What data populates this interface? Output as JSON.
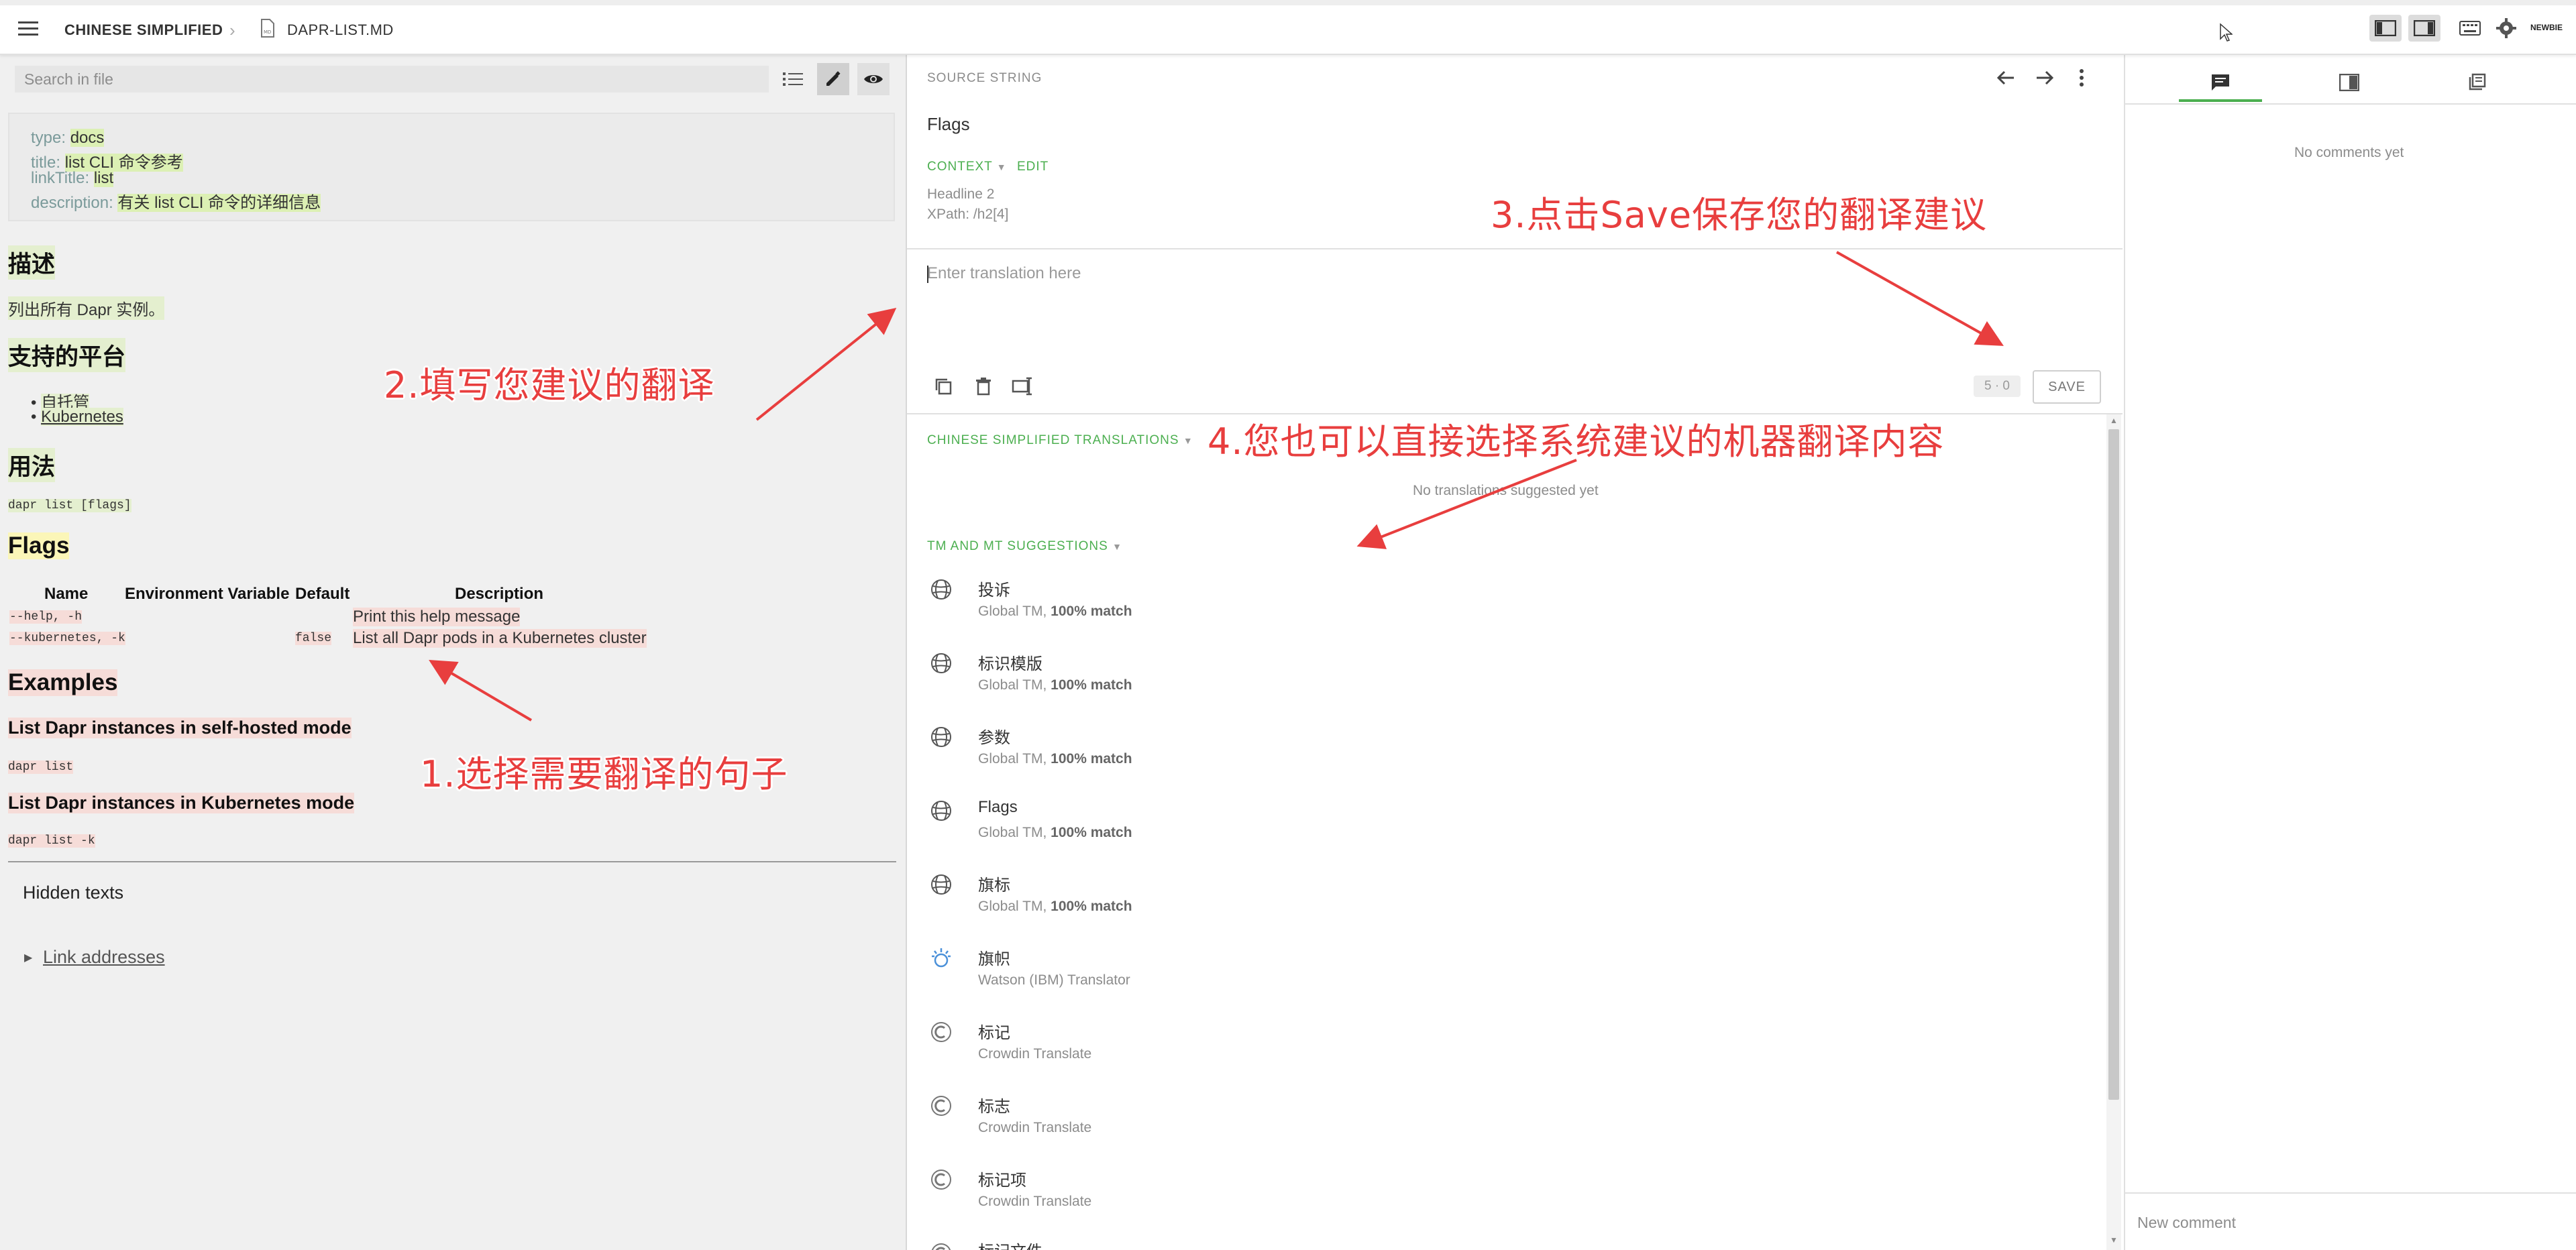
{
  "header": {
    "project": "CHINESE SIMPLIFIED",
    "file": "DAPR-LIST.MD",
    "user_badge": "NEWBIE"
  },
  "left": {
    "search_placeholder": "Search in file",
    "front_matter": [
      {
        "key": "type:",
        "value": "docs"
      },
      {
        "key": "title:",
        "value": "list CLI 命令参考"
      },
      {
        "key": "linkTitle:",
        "value": "list"
      },
      {
        "key": "description:",
        "value": "有关 list CLI 命令的详细信息"
      }
    ],
    "h_description": "描述",
    "p_description": "列出所有 Dapr 实例。",
    "h_platforms": "支持的平台",
    "platforms": [
      "自托管",
      "Kubernetes"
    ],
    "h_usage": "用法",
    "code_usage": "dapr list [flags]",
    "h_flags": "Flags",
    "table_headers": [
      "Name",
      "Environment Variable",
      "Default",
      "Description"
    ],
    "table_rows": [
      {
        "name": "--help, -h",
        "env": "",
        "default": "",
        "desc": "Print this help message"
      },
      {
        "name": "--kubernetes, -k",
        "env": "",
        "default": "false",
        "desc": "List all Dapr pods in a Kubernetes cluster"
      }
    ],
    "h_examples": "Examples",
    "h_selfhosted": "List Dapr instances in self-hosted mode",
    "code_selfhosted": "dapr list",
    "h_k8s": "List Dapr instances in Kubernetes mode",
    "code_k8s": "dapr list -k",
    "hidden_texts": "Hidden texts",
    "link_addresses": "Link addresses"
  },
  "middle": {
    "source_label": "SOURCE STRING",
    "source_text": "Flags",
    "context_label": "CONTEXT",
    "edit_label": "EDIT",
    "context_line1": "Headline 2",
    "context_line2": "XPath: /h2[4]",
    "translation_placeholder": "Enter translation here",
    "counter": "5 · 0",
    "save_label": "SAVE",
    "translations_label": "CHINESE SIMPLIFIED TRANSLATIONS",
    "no_translations": "No translations suggested yet",
    "tm_label": "TM AND MT SUGGESTIONS",
    "suggestions": [
      {
        "text": "投诉",
        "source": "Global TM, ",
        "match": "100% match",
        "icon": "global-tm-icon"
      },
      {
        "text": "标识模版",
        "source": "Global TM, ",
        "match": "100% match",
        "icon": "global-tm-icon"
      },
      {
        "text": "参数",
        "source": "Global TM, ",
        "match": "100% match",
        "icon": "global-tm-icon"
      },
      {
        "text": "Flags",
        "source": "Global TM, ",
        "match": "100% match",
        "icon": "global-tm-icon"
      },
      {
        "text": "旗标",
        "source": "Global TM, ",
        "match": "100% match",
        "icon": "global-tm-icon"
      },
      {
        "text": "旗帜",
        "source": "Watson (IBM) Translator",
        "match": "",
        "icon": "watson-icon"
      },
      {
        "text": "标记",
        "source": "Crowdin Translate",
        "match": "",
        "icon": "crowdin-translate-icon"
      },
      {
        "text": "标志",
        "source": "Crowdin Translate",
        "match": "",
        "icon": "crowdin-translate-icon"
      },
      {
        "text": "标记项",
        "source": "Crowdin Translate",
        "match": "",
        "icon": "crowdin-translate-icon"
      },
      {
        "text": "标记文件",
        "source": "",
        "match": "",
        "icon": "crowdin-translate-icon"
      }
    ]
  },
  "right": {
    "no_comments": "No comments yet",
    "new_comment_placeholder": "New comment"
  },
  "annotations": {
    "step1": "1.选择需要翻译的句子",
    "step2": "2.填写您建议的翻译",
    "step3": "3.点击Save保存您的翻译建议",
    "step4": "4.您也可以直接选择系统建议的机器翻译内容"
  },
  "colors": {
    "accent_green": "#4caf50",
    "annotation_red": "#e83e3e",
    "highlight_green": "#dcf0b4"
  }
}
